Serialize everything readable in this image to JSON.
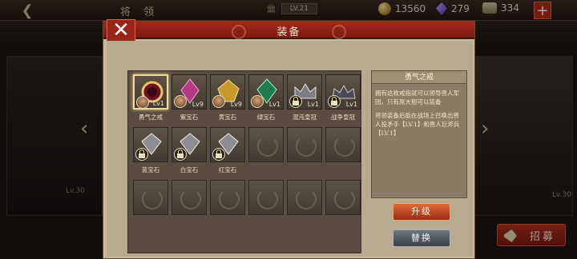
{
  "topbar": {
    "title": "将 领",
    "rank_badge": "LV.21",
    "resources": [
      {
        "name": "coins",
        "value": "13560"
      },
      {
        "name": "gems",
        "value": "279"
      },
      {
        "name": "food",
        "value": "334"
      }
    ],
    "plus_label": "+"
  },
  "background": {
    "left_lock_text": "Lv.30",
    "right_lv_text": "Lv.30",
    "recruit_label": "招募"
  },
  "modal": {
    "title": "装备",
    "close_label": "✕",
    "slots": [
      {
        "label": "勇气之戒",
        "lv": "Lv1",
        "badge": "face",
        "art": "ring",
        "selected": true
      },
      {
        "label": "紫宝石",
        "lv": "Lv9",
        "badge": "face",
        "art": "purple-gem"
      },
      {
        "label": "黄宝石",
        "lv": "Lv9",
        "badge": "face",
        "art": "yellow-gem"
      },
      {
        "label": "绿宝石",
        "lv": "Lv1",
        "badge": "face",
        "art": "green-gem"
      },
      {
        "label": "混沌皇冠",
        "lv": "Lv1",
        "badge": "lock",
        "art": "crown"
      },
      {
        "label": "战争皇冠",
        "lv": "Lv1",
        "badge": "lock",
        "art": "crown2"
      },
      {
        "label": "蓝宝石",
        "lv": "",
        "badge": "lock",
        "art": "gem-silver"
      },
      {
        "label": "白宝石",
        "lv": "",
        "badge": "lock",
        "art": "gem-silver"
      },
      {
        "label": "红宝石",
        "lv": "",
        "badge": "lock",
        "art": "gem-silver"
      }
    ],
    "detail": {
      "title": "勇气之戒",
      "para1": "拥有这枚戒指就可以领导兽人军团，只有屌大粗可以装备",
      "para2": "将领装备后能在战场上召唤出兽人投矛手【LV.1】和兽人巨斧兵【LV.1】"
    },
    "upgrade_label": "升级",
    "replace_label": "替换"
  },
  "colors": {
    "header_red": "#a4291c",
    "panel_tan": "#c5b99f",
    "upgrade_orange": "#e06a3a",
    "replace_gray": "#6e7480"
  }
}
